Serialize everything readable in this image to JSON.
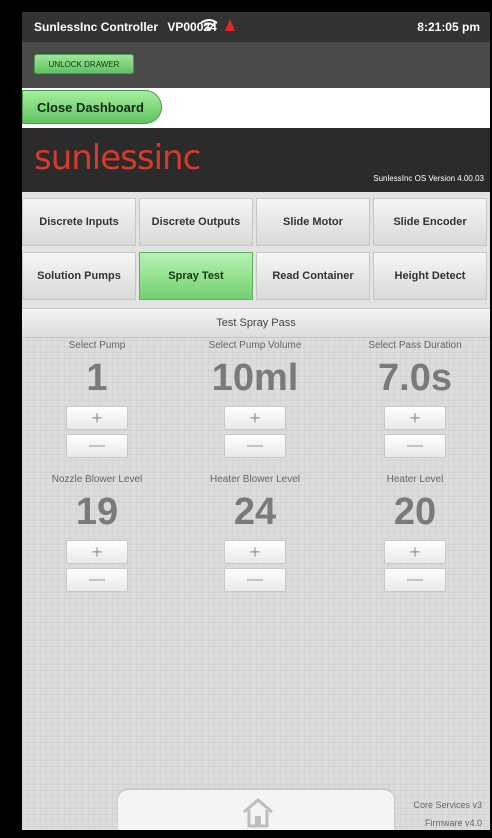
{
  "status": {
    "app_title": "SunlessInc Controller",
    "device_id": "VP00024",
    "time": "8:21:05 pm"
  },
  "header": {
    "unlock_label": "UNLOCK DRAWER",
    "close_label": "Close Dashboard",
    "logo_main": "sunless",
    "logo_sub": "inc",
    "os_version": "SunlessInc OS Version 4.00.03"
  },
  "tabs": [
    {
      "label": "Discrete Inputs"
    },
    {
      "label": "Discrete Outputs"
    },
    {
      "label": "Slide Motor"
    },
    {
      "label": "Slide Encoder"
    },
    {
      "label": "Solution Pumps"
    },
    {
      "label": "Spray Test",
      "active": true
    },
    {
      "label": "Read Container"
    },
    {
      "label": "Height Detect"
    }
  ],
  "spray": {
    "title": "Test Spray Pass",
    "controls": [
      {
        "label": "Select Pump",
        "value": "1"
      },
      {
        "label": "Select Pump Volume",
        "value": "10ml"
      },
      {
        "label": "Select Pass Duration",
        "value": "7.0s"
      },
      {
        "label": "Nozzle Blower Level",
        "value": "19"
      },
      {
        "label": "Heater Blower Level",
        "value": "24"
      },
      {
        "label": "Heater Level",
        "value": "20"
      }
    ],
    "plus_symbol": "+",
    "minus_symbol": "—"
  },
  "footer": {
    "core_services": "Core Services v3",
    "firmware": "Firmware v4.0"
  },
  "colors": {
    "accent_green": "#73d06f",
    "logo_red": "#d53a2a"
  }
}
